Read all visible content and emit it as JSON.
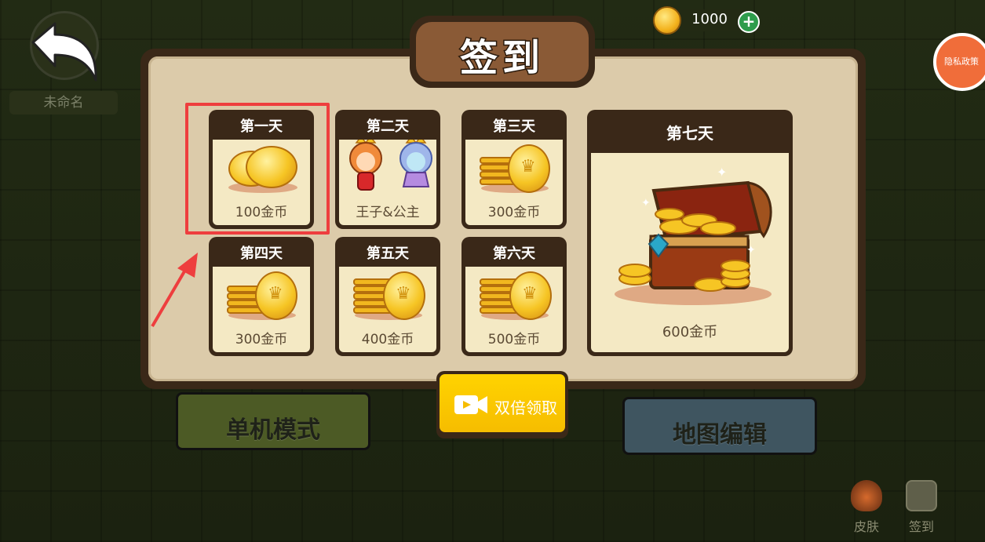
{
  "top": {
    "player_name": "未命名",
    "coins": "1000",
    "privacy_label": "隐私政策"
  },
  "dialog": {
    "title": "签到",
    "days": [
      {
        "label": "第一天",
        "reward": "100金币"
      },
      {
        "label": "第二天",
        "reward": "王子&公主"
      },
      {
        "label": "第三天",
        "reward": "300金币"
      },
      {
        "label": "第四天",
        "reward": "300金币"
      },
      {
        "label": "第五天",
        "reward": "400金币"
      },
      {
        "label": "第六天",
        "reward": "500金币"
      },
      {
        "label": "第七天",
        "reward": "600金币"
      }
    ],
    "double_button": "双倍领取"
  },
  "background_buttons": {
    "single_mode": "单机模式",
    "map_editor": "地图编辑"
  },
  "corner": {
    "skin": "皮肤",
    "signin": "签到"
  },
  "colors": {
    "highlight": "#ee3e3e",
    "accent_button": "#ffd300",
    "dialog_border": "#3a2818"
  }
}
